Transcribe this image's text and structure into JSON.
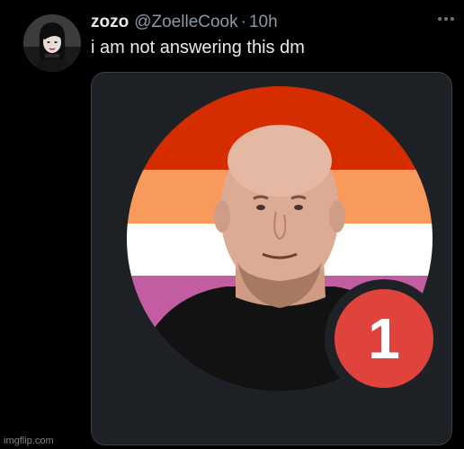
{
  "tweet": {
    "display_name": "zozo",
    "handle": "@ZoelleCook",
    "separator": "·",
    "timestamp": "10h",
    "text": "i am not answering this dm"
  },
  "media": {
    "notification_badge": "1",
    "flag_stripe_colors": [
      "#d52d00",
      "#ff9a56",
      "#ffffff",
      "#d362a4"
    ],
    "badge_color": "#e0423c"
  },
  "icons": {
    "more": "more-options-icon"
  },
  "watermark": "imgflip.com"
}
